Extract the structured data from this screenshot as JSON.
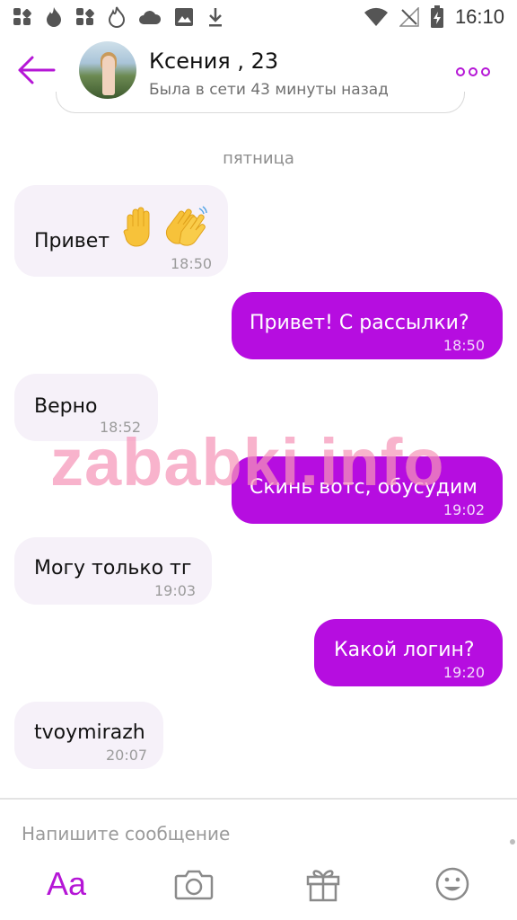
{
  "status_bar": {
    "time": "16:10",
    "left_icons": [
      "grid-icon",
      "flame-icon",
      "grid-icon",
      "flame-icon",
      "cloud-icon",
      "image-icon",
      "download-icon"
    ],
    "right_icons": [
      "wifi-icon",
      "no-signal-icon",
      "battery-charging-icon"
    ]
  },
  "header": {
    "name": "Ксения , 23",
    "last_seen": "Была в сети 43 минуты назад",
    "accent_color": "#b516d6"
  },
  "chat": {
    "day_label": "пятница",
    "messages": [
      {
        "direction": "in",
        "text": "Привет",
        "emoji": [
          "raised-hand-emoji",
          "waving-hands-emoji"
        ],
        "time": "18:50"
      },
      {
        "direction": "out",
        "text": "Привет! С рассылки?",
        "time": "18:50"
      },
      {
        "direction": "in",
        "text": "Верно",
        "time": "18:52"
      },
      {
        "direction": "out",
        "text": "Скинь вотс, обусудим",
        "time": "19:02"
      },
      {
        "direction": "in",
        "text": "Могу только тг",
        "time": "19:03"
      },
      {
        "direction": "out",
        "text": "Какой логин?",
        "time": "19:20"
      },
      {
        "direction": "in",
        "text": "tvoymirazh",
        "time": "20:07"
      }
    ],
    "outgoing_color": "#b60de0",
    "incoming_color": "#f6f1f9"
  },
  "watermark": "zababki.info",
  "composer": {
    "placeholder": "Напишите сообщение",
    "format_label": "Aa",
    "tools": [
      "text-format-icon",
      "camera-icon",
      "gift-icon",
      "smiley-icon"
    ]
  }
}
